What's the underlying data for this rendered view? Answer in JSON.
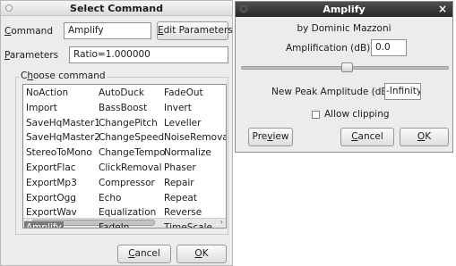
{
  "select_command": {
    "title": "Select Command",
    "command_label": "Command",
    "command_value": "Amplify",
    "edit_parameters_label": "Edit Parameters",
    "parameters_label": "Parameters",
    "parameters_value": "Ratio=1.000000",
    "choose_label": "Choose command",
    "columns": [
      [
        "NoAction",
        "Import",
        "SaveHqMaster1",
        "SaveHqMaster2",
        "StereoToMono",
        "ExportFlac",
        "ExportMp3",
        "ExportOgg",
        "ExportWav",
        "Amplify"
      ],
      [
        "AutoDuck",
        "BassBoost",
        "ChangePitch",
        "ChangeSpeed",
        "ChangeTempo",
        "ClickRemoval",
        "Compressor",
        "Echo",
        "Equalization",
        "FadeIn"
      ],
      [
        "FadeOut",
        "Invert",
        "Leveller",
        "NoiseRemoval",
        "Normalize",
        "Phaser",
        "Repair",
        "Repeat",
        "Reverse",
        "TimeScale"
      ]
    ],
    "selected_item": "Amplify",
    "cancel_label": "Cancel",
    "ok_label": "OK",
    "scroll_left": "‹",
    "scroll_right": "›"
  },
  "amplify": {
    "title": "Amplify",
    "close_glyph": "×",
    "author": "by Dominic Mazzoni",
    "amplification_label": "Amplification (dB):",
    "amplification_value": "0.0",
    "slider_level_fraction": 0.51,
    "new_peak_label": "New Peak Amplitude (dB):",
    "new_peak_value": "-Infinity",
    "allow_clipping_label": "Allow clipping",
    "allow_clipping_checked": false,
    "preview_label": "Preview",
    "cancel_label": "Cancel",
    "ok_label": "OK"
  }
}
